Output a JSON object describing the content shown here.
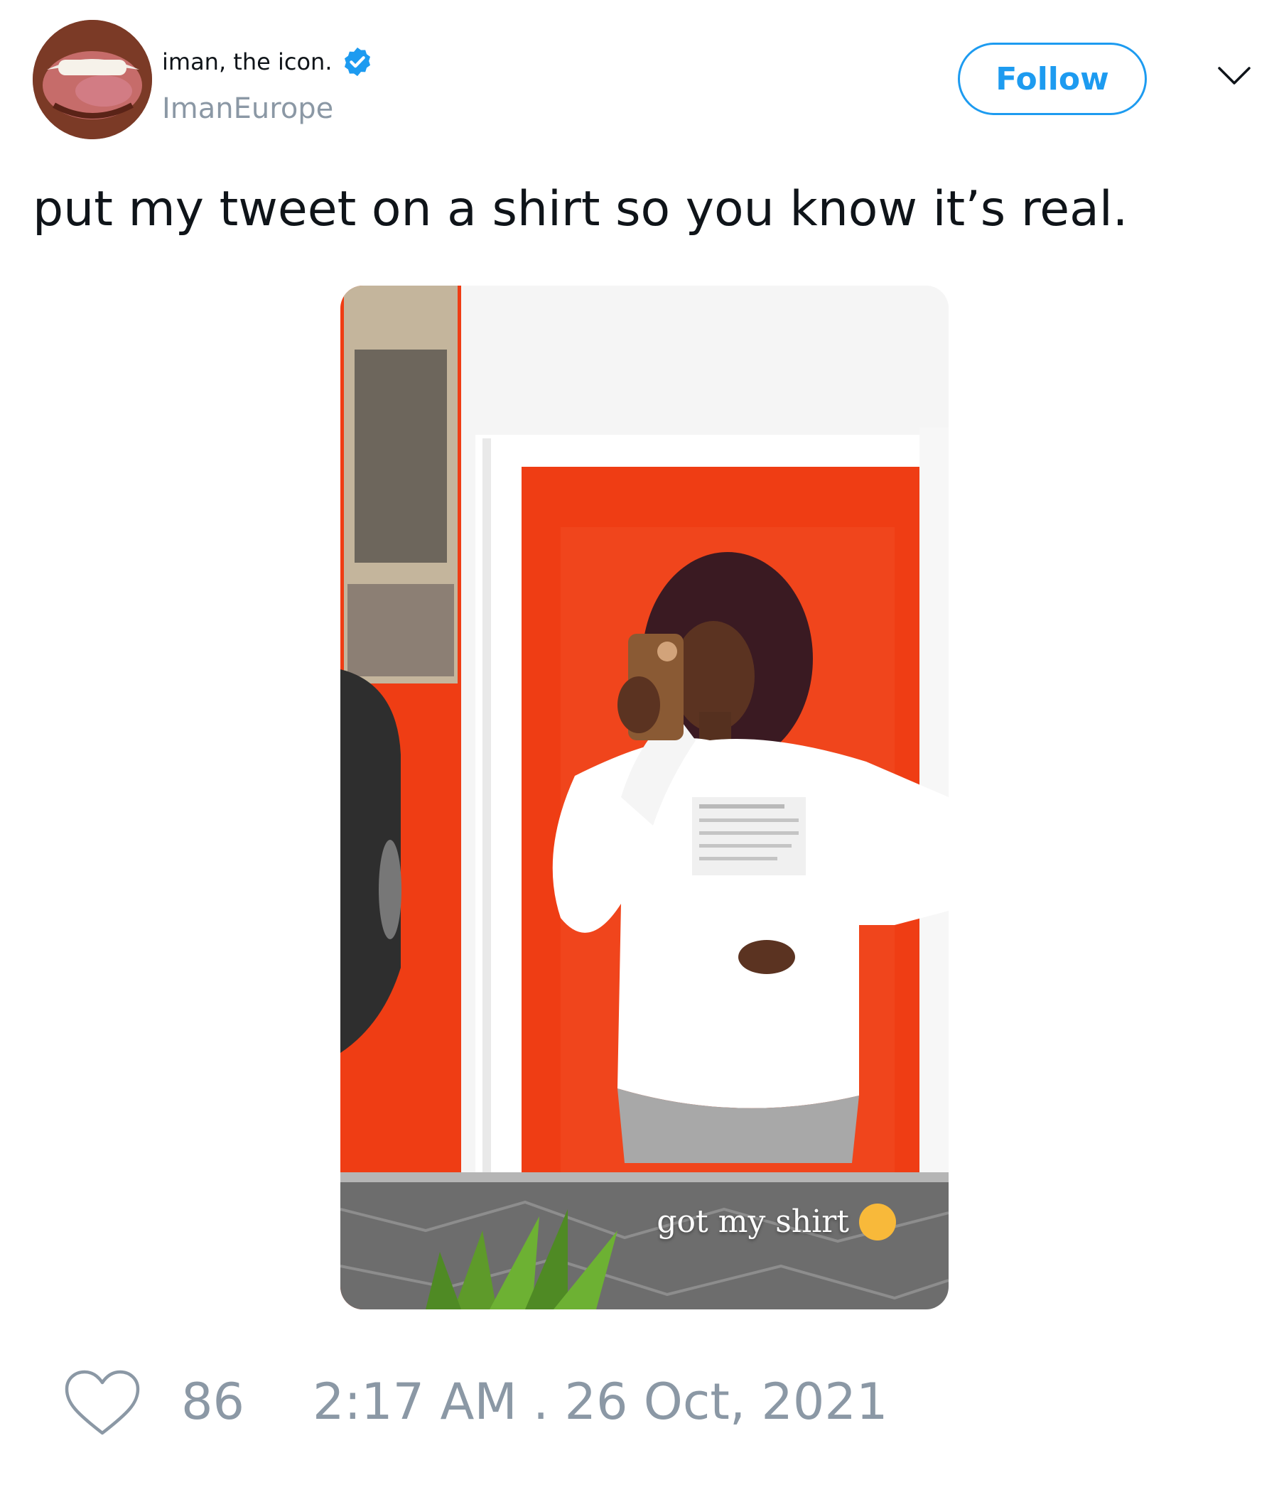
{
  "user": {
    "display_name": "iman, the icon.",
    "handle": "ImanEurope",
    "verified": true,
    "verified_icon": "verified-badge-icon",
    "avatar_icon": "profile-avatar"
  },
  "header": {
    "follow_label": "Follow",
    "menu_icon": "chevron-down-icon"
  },
  "tweet": {
    "text": "put my tweet on a shirt so you know it’s real.",
    "media": {
      "type": "photo",
      "story_caption": "got my shirt"
    }
  },
  "footer": {
    "like_icon": "heart-icon",
    "like_count": "86",
    "timestamp": "2:17 AM . 26 Oct, 2021"
  },
  "colors": {
    "accent": "#1d9bf0",
    "muted": "#8b98a5",
    "text": "#0f1419"
  }
}
